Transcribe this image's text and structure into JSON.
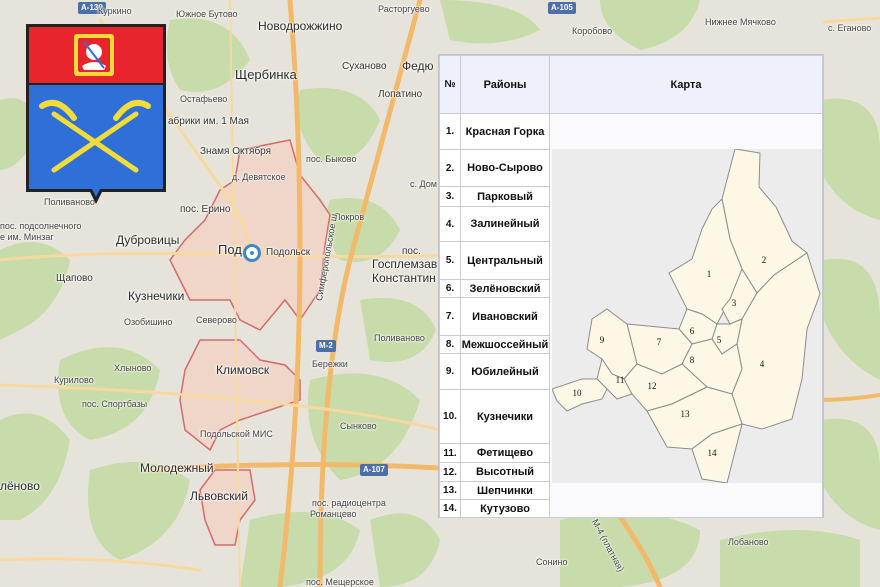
{
  "map": {
    "labels": {
      "a130": "А-130",
      "kurkino": "Куркино",
      "yuzhnoe_butovo": "Южное Бутово",
      "novodrozhzhino": "Новодрожжино",
      "rastorguevo": "Расторгуево",
      "a105": "А-105",
      "nizhnee_myachkovo": "Нижнее Мячково",
      "korobovo": "Коробово",
      "s_eganovo": "с. Еганово",
      "scherbinka": "Щербинка",
      "sukhanovo": "Суханово",
      "fedyu": "Федю",
      "ostafevo": "Остафьево",
      "fabriki": "абрики им. 1 Мая",
      "lopatino": "Лопатино",
      "znamya": "Знамя Октября",
      "pos_bykovo": "пос. Быково",
      "d_devyatskoe": "д. Девятское",
      "s_dom": "с. Дом",
      "polivanovo_w": "Поливаново",
      "pos_erino": "пос. Ерино",
      "pokrov": "Покров",
      "pos_podsolnech": "пос. подсолнечного",
      "minzag": "е им. Минзаг",
      "dubrovitsy": "Дубровицы",
      "pod": "Под",
      "podolsk": "Подольск",
      "simferopol": "Симферопольское ш.",
      "pos": "пос.",
      "gosplemzav": "Госплемзав",
      "konstantin": "Константин",
      "schapovo": "Щапово",
      "kuznechiki": "Кузнечики",
      "ozobishino": "Озобишино",
      "severovo": "Северово",
      "polivanovo_e": "Поливаново",
      "berezhki": "Бережки",
      "khlynovo": "Хлыново",
      "klimovsk": "Климовск",
      "kurilovo": "Курилово",
      "pos_sportbazy": "пос. Спортбазы",
      "podolskoy_mis": "Подольской МИС",
      "synkovo": "Сынково",
      "molodezhny": "Молодежный",
      "a107": "А-107",
      "lenovo": "лёново",
      "lvovsky": "Львовский",
      "pos_radiocentra": "пос. радиоцентра",
      "romanzevo": "Романцево",
      "m2": "М-2",
      "m4": "М-4 (платная)",
      "sonino": "Сонино",
      "lobanovo": "Лобаново",
      "pos_meshcherskoe": "пос. Мещерское"
    },
    "colors": {
      "land": "#e6e4da",
      "forest": "#c7dcaa",
      "city": "#f0d6c8",
      "boundary": "#d36b6b",
      "road_major": "#f3b96a",
      "road_minor": "#f7d9a0",
      "badge": "#4d6fa8",
      "pin": "#3f88c5"
    }
  },
  "coat_of_arms": {
    "colors": {
      "top": "#e8242c",
      "bottom": "#2f6fd8",
      "tools": "#f2dc3a",
      "border": "#222222"
    },
    "icon": "crossed-pickaxes-icon"
  },
  "table": {
    "headers": {
      "num": "№",
      "name": "Районы",
      "map": "Карта"
    },
    "rows": [
      {
        "num": "1.",
        "name": "Красная Горка"
      },
      {
        "num": "2.",
        "name": "Ново-Сырово"
      },
      {
        "num": "3.",
        "name": "Парковый"
      },
      {
        "num": "4.",
        "name": "Залинейный"
      },
      {
        "num": "5.",
        "name": "Центральный"
      },
      {
        "num": "6.",
        "name": "Зелёновский"
      },
      {
        "num": "7.",
        "name": "Ивановский"
      },
      {
        "num": "8.",
        "name": "Межшоссейный"
      },
      {
        "num": "9.",
        "name": "Юбилейный"
      },
      {
        "num": "10.",
        "name": "Кузнечики"
      },
      {
        "num": "11.",
        "name": "Фетищево"
      },
      {
        "num": "12.",
        "name": "Высотный"
      },
      {
        "num": "13.",
        "name": "Шепчинки"
      },
      {
        "num": "14.",
        "name": "Кутузово"
      }
    ]
  },
  "district_map": {
    "labels": [
      "1",
      "2",
      "3",
      "4",
      "5",
      "6",
      "7",
      "8",
      "9",
      "10",
      "11",
      "12",
      "13",
      "14"
    ],
    "colors": {
      "fill": "#fdf8e6",
      "stroke": "#8c8c8c",
      "bg": "#ececec"
    }
  }
}
